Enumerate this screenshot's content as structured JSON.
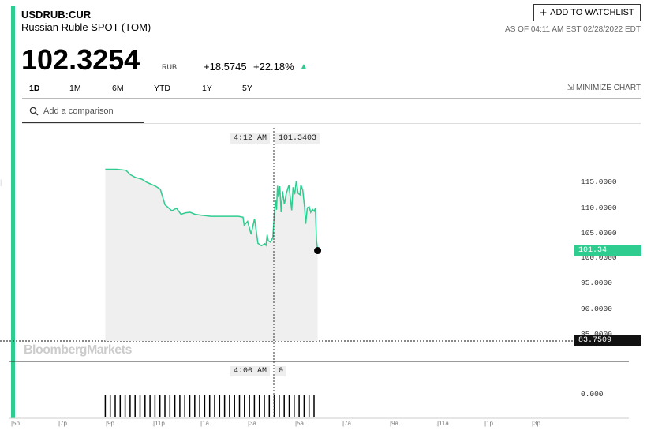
{
  "header": {
    "ticker": "USDRUB:CUR",
    "name": "Russian Ruble SPOT (TOM)",
    "price": "102.3254",
    "unit": "RUB",
    "change": "+18.5745",
    "change_pct": "+22.18%",
    "watchlist_label": "ADD TO WATCHLIST",
    "as_of": "AS OF 04:11 AM EST 02/28/2022 EDT"
  },
  "ranges": [
    "1D",
    "1M",
    "6M",
    "YTD",
    "1Y",
    "5Y"
  ],
  "active_range": "1D",
  "minimize_label": "MINIMIZE CHART",
  "search": {
    "placeholder": "Add a comparison"
  },
  "hover": {
    "time": "4:12 AM",
    "value": "101.3403",
    "volume_time": "4:00 AM",
    "volume_value": "0"
  },
  "current_price_tag": "101.34",
  "previous_close_tag": "83.7509",
  "watermark": "BloombergMarkets",
  "y_axis_labels": [
    "115.0000",
    "110.0000",
    "105.0000",
    "100.0000",
    "95.0000",
    "90.0000",
    "85.0000"
  ],
  "volume_axis_label": "0.000",
  "x_axis_labels": [
    "5p",
    "7p",
    "9p",
    "11p",
    "1a",
    "3a",
    "5a",
    "7a",
    "9a",
    "11a",
    "1p",
    "3p"
  ],
  "chart_data": {
    "type": "line",
    "ylim": [
      83,
      122
    ],
    "x_unit": "hours since 5p",
    "series": [
      {
        "values": [
          [
            4.0,
            117.6
          ],
          [
            4.5,
            117.6
          ],
          [
            4.9,
            117.4
          ],
          [
            5.1,
            116.5
          ],
          [
            5.3,
            116.0
          ],
          [
            5.6,
            115.6
          ],
          [
            5.8,
            115.0
          ],
          [
            6.0,
            114.6
          ],
          [
            6.2,
            114.2
          ],
          [
            6.4,
            113.6
          ],
          [
            6.6,
            110.5
          ],
          [
            6.9,
            109.3
          ],
          [
            7.1,
            109.8
          ],
          [
            7.3,
            108.6
          ],
          [
            7.5,
            108.9
          ],
          [
            7.7,
            109.0
          ],
          [
            7.9,
            108.6
          ],
          [
            8.2,
            108.4
          ],
          [
            8.6,
            108.2
          ],
          [
            9.0,
            108.2
          ],
          [
            9.4,
            108.2
          ],
          [
            9.8,
            108.2
          ],
          [
            10.0,
            108.0
          ],
          [
            10.05,
            106.4
          ],
          [
            10.2,
            107.2
          ],
          [
            10.35,
            104.6
          ],
          [
            10.5,
            107.7
          ],
          [
            10.65,
            102.8
          ],
          [
            10.8,
            102.3
          ],
          [
            10.95,
            102.7
          ],
          [
            11.0,
            102.4
          ],
          [
            11.05,
            104.5
          ],
          [
            11.1,
            103.3
          ],
          [
            11.2,
            103.0
          ],
          [
            11.3,
            104.0
          ],
          [
            11.38,
            109.8
          ],
          [
            11.42,
            111.4
          ],
          [
            11.46,
            109.5
          ],
          [
            11.5,
            114.3
          ],
          [
            11.55,
            112.0
          ],
          [
            11.6,
            114.2
          ],
          [
            11.66,
            109.0
          ],
          [
            11.72,
            113.2
          ],
          [
            11.8,
            110.6
          ],
          [
            11.88,
            112.7
          ],
          [
            11.95,
            113.7
          ],
          [
            12.0,
            114.5
          ],
          [
            12.05,
            112.2
          ],
          [
            12.12,
            109.4
          ],
          [
            12.18,
            114.0
          ],
          [
            12.25,
            112.6
          ],
          [
            12.32,
            115.3
          ],
          [
            12.4,
            112.8
          ],
          [
            12.48,
            112.5
          ],
          [
            12.52,
            114.5
          ],
          [
            12.6,
            113.4
          ],
          [
            12.68,
            110.0
          ],
          [
            12.73,
            106.7
          ],
          [
            12.8,
            109.9
          ],
          [
            12.88,
            110.1
          ],
          [
            12.95,
            109.0
          ],
          [
            13.02,
            109.6
          ],
          [
            13.1,
            109.2
          ],
          [
            13.15,
            109.8
          ],
          [
            13.2,
            103.4
          ],
          [
            13.25,
            101.34
          ]
        ]
      }
    ],
    "reference_lines": [
      {
        "name": "previous close",
        "value": 83.7509
      }
    ]
  },
  "colors": {
    "accent": "#2ecc8f",
    "line": "#2ecc8f",
    "fill": "#efefef",
    "prev_close": "#111111"
  }
}
